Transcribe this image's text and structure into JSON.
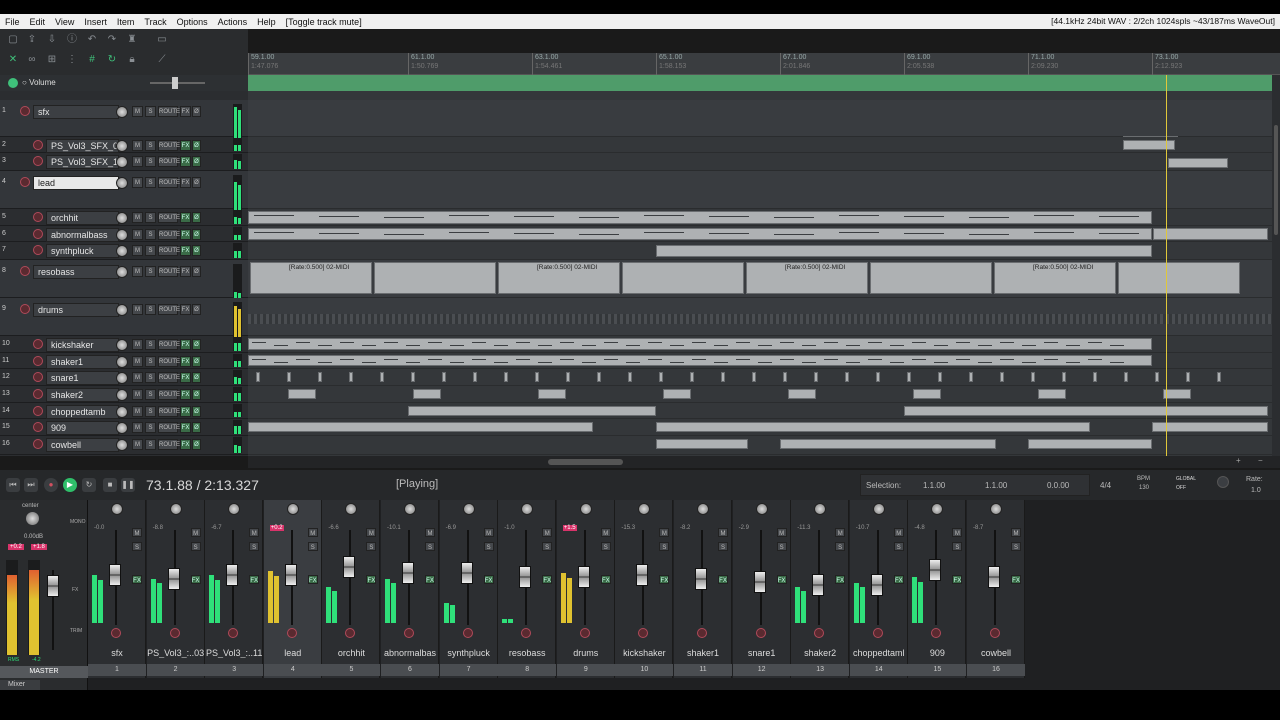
{
  "menu": {
    "items": [
      "File",
      "Edit",
      "View",
      "Insert",
      "Item",
      "Track",
      "Options",
      "Actions",
      "Help",
      "[Toggle track mute]"
    ],
    "status": "[44.1kHz 24bit WAV : 2/2ch 1024spls ~43/187ms WaveOut]"
  },
  "ruler": {
    "marks": [
      {
        "bar": "59.1.00",
        "time": "1:47.076"
      },
      {
        "bar": "61.1.00",
        "time": "1:50.769"
      },
      {
        "bar": "63.1.00",
        "time": "1:54.461"
      },
      {
        "bar": "65.1.00",
        "time": "1:58.153"
      },
      {
        "bar": "67.1.00",
        "time": "2:01.846"
      },
      {
        "bar": "69.1.00",
        "time": "2:05.538"
      },
      {
        "bar": "71.1.00",
        "time": "2:09.230"
      },
      {
        "bar": "73.1.00",
        "time": "2:12.923"
      }
    ]
  },
  "envelope": {
    "label": "Volume"
  },
  "tracks": [
    {
      "num": "1",
      "name": "sfx",
      "folder": true
    },
    {
      "num": "2",
      "name": "PS_Vol3_SFX_03"
    },
    {
      "num": "3",
      "name": "PS_Vol3_SFX_11"
    },
    {
      "num": "4",
      "name": "lead",
      "folder": true,
      "selected": true
    },
    {
      "num": "5",
      "name": "orchhit"
    },
    {
      "num": "6",
      "name": "abnormalbass"
    },
    {
      "num": "7",
      "name": "synthpluck"
    },
    {
      "num": "8",
      "name": "resobass",
      "folder": true
    },
    {
      "num": "9",
      "name": "drums",
      "folder": true
    },
    {
      "num": "10",
      "name": "kickshaker"
    },
    {
      "num": "11",
      "name": "shaker1"
    },
    {
      "num": "12",
      "name": "snare1"
    },
    {
      "num": "13",
      "name": "shaker2"
    },
    {
      "num": "14",
      "name": "choppedtamb"
    },
    {
      "num": "15",
      "name": "909"
    },
    {
      "num": "16",
      "name": "cowbell"
    }
  ],
  "buttons": {
    "mute": "M",
    "solo": "S",
    "route": "ROUTE",
    "fx": "FX",
    "env": "Ø"
  },
  "item_label": "[Rate:0.500] 02-MIDI",
  "transport": {
    "time": "73.1.88 / 2:13.327",
    "state": "[Playing]",
    "selection_label": "Selection:",
    "sel_start": "1.1.00",
    "sel_end": "1.1.00",
    "sel_len": "0.0.00",
    "timesig": "4/4",
    "bpm_label": "BPM",
    "bpm": "130",
    "global_label": "GLOBAL",
    "global_state": "OFF",
    "rate_label": "Rate:",
    "rate": "1.0"
  },
  "master": {
    "label": "MASTER",
    "pan": "center",
    "vol": "0.00dB",
    "peak_l": "+0.2",
    "peak_r": "+1.8",
    "rms_label": "RMS",
    "rms_val": "-4.2",
    "side": [
      "MONO",
      "FX",
      "TRIM"
    ]
  },
  "mixer": {
    "label": "Mixer",
    "strips": [
      {
        "name": "sfx",
        "num": "1",
        "peak": "-0.0",
        "meter": 0.6,
        "fader": 0.55
      },
      {
        "name": "PS_Vol3_:..03",
        "num": "2",
        "peak": "-8.8",
        "meter": 0.55,
        "fader": 0.5
      },
      {
        "name": "PS_Vol3_:..11",
        "num": "3",
        "peak": "-6.7",
        "meter": 0.6,
        "fader": 0.55
      },
      {
        "name": "lead",
        "num": "4",
        "peak": "+0.2",
        "meter": 0.65,
        "fader": 0.55,
        "selected": true,
        "yellow": true
      },
      {
        "name": "orchhit",
        "num": "5",
        "peak": "-6.6",
        "meter": 0.45,
        "fader": 0.65
      },
      {
        "name": "abnormalbas",
        "num": "6",
        "peak": "-10.1",
        "meter": 0.55,
        "fader": 0.58
      },
      {
        "name": "synthpluck",
        "num": "7",
        "peak": "-6.9",
        "meter": 0.25,
        "fader": 0.58
      },
      {
        "name": "resobass",
        "num": "8",
        "peak": "-1.0",
        "meter": 0.05,
        "fader": 0.52
      },
      {
        "name": "drums",
        "num": "9",
        "peak": "+1.5",
        "meter": 0.62,
        "fader": 0.52,
        "yellow": true
      },
      {
        "name": "kickshaker",
        "num": "10",
        "peak": "-15.3",
        "meter": 0.0,
        "fader": 0.55
      },
      {
        "name": "shaker1",
        "num": "11",
        "peak": "-8.2",
        "meter": 0.0,
        "fader": 0.5
      },
      {
        "name": "snare1",
        "num": "12",
        "peak": "-2.9",
        "meter": 0.0,
        "fader": 0.45
      },
      {
        "name": "shaker2",
        "num": "13",
        "peak": "-11.3",
        "meter": 0.45,
        "fader": 0.42
      },
      {
        "name": "choppedtaml",
        "num": "14",
        "peak": "-10.7",
        "meter": 0.5,
        "fader": 0.42
      },
      {
        "name": "909",
        "num": "15",
        "peak": "-4.8",
        "meter": 0.58,
        "fader": 0.62
      },
      {
        "name": "cowbell",
        "num": "16",
        "peak": "-8.7",
        "meter": 0.0,
        "fader": 0.52
      }
    ]
  }
}
